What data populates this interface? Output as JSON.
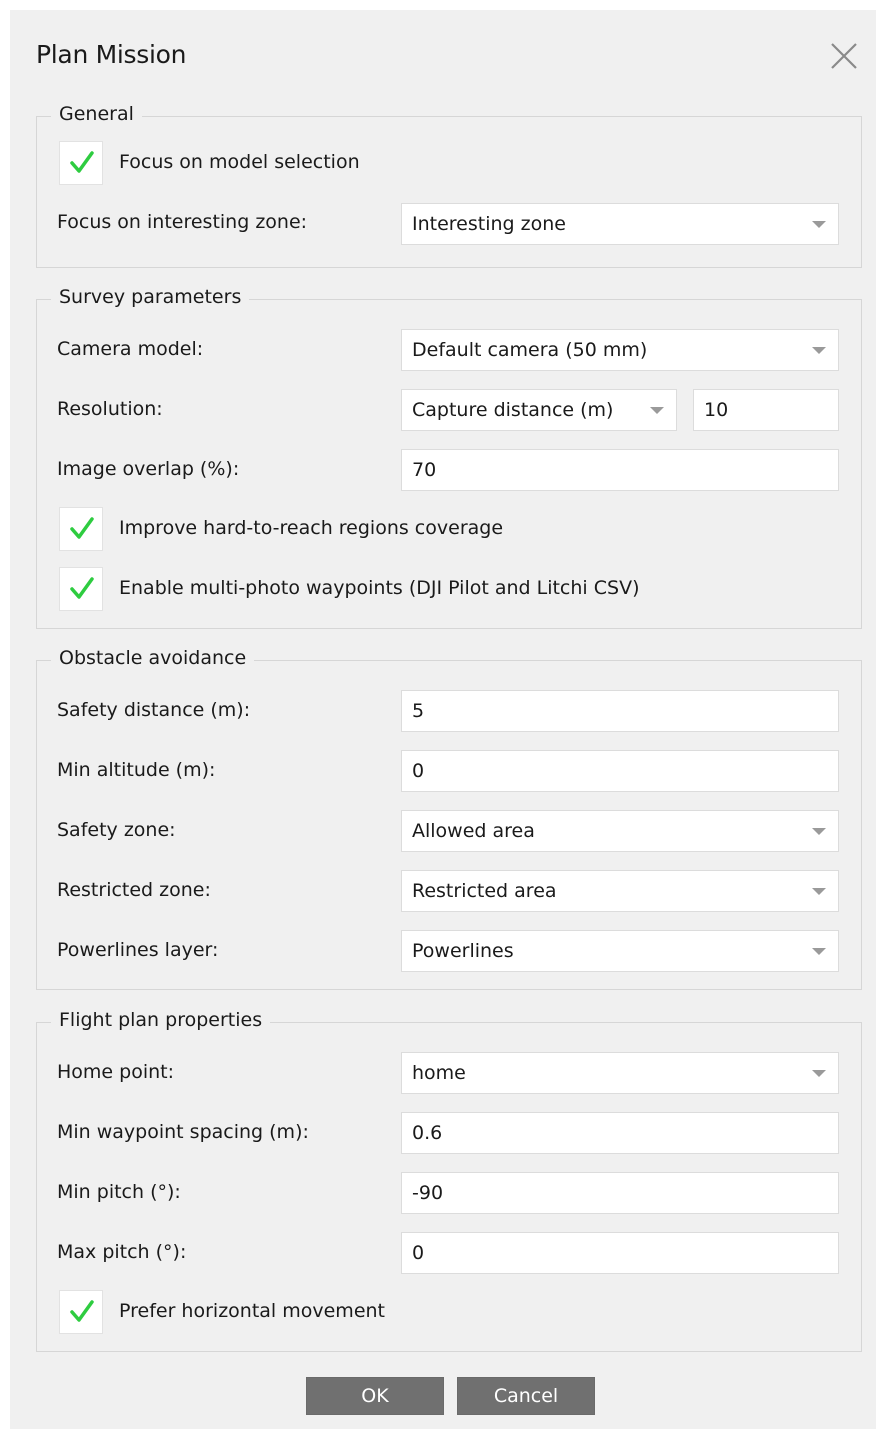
{
  "dialog": {
    "title": "Plan Mission"
  },
  "general": {
    "title": "General",
    "focus_model_label": "Focus on model selection",
    "focus_model_checked": true,
    "interesting_zone_label": "Focus on interesting zone:",
    "interesting_zone_value": "Interesting zone"
  },
  "survey": {
    "title": "Survey parameters",
    "camera_label": "Camera model:",
    "camera_value": "Default camera (50 mm)",
    "resolution_label": "Resolution:",
    "resolution_mode": "Capture distance (m)",
    "resolution_value": "10",
    "overlap_label": "Image overlap (%):",
    "overlap_value": "70",
    "hard_regions_label": "Improve hard-to-reach regions coverage",
    "hard_regions_checked": true,
    "multiphoto_label": "Enable multi-photo waypoints (DJI Pilot and Litchi CSV)",
    "multiphoto_checked": true
  },
  "obstacle": {
    "title": "Obstacle avoidance",
    "safety_distance_label": "Safety distance (m):",
    "safety_distance_value": "5",
    "min_altitude_label": "Min altitude (m):",
    "min_altitude_value": "0",
    "safety_zone_label": "Safety zone:",
    "safety_zone_value": "Allowed area",
    "restricted_zone_label": "Restricted zone:",
    "restricted_zone_value": "Restricted area",
    "powerlines_label": "Powerlines layer:",
    "powerlines_value": "Powerlines"
  },
  "flight": {
    "title": "Flight plan properties",
    "home_label": "Home point:",
    "home_value": "home",
    "spacing_label": "Min waypoint spacing (m):",
    "spacing_value": "0.6",
    "min_pitch_label": "Min pitch (°):",
    "min_pitch_value": "-90",
    "max_pitch_label": "Max pitch (°):",
    "max_pitch_value": "0",
    "horizontal_label": "Prefer horizontal movement",
    "horizontal_checked": true
  },
  "buttons": {
    "ok": "OK",
    "cancel": "Cancel"
  },
  "icons": {
    "close": "close-icon",
    "check": "checkmark-icon",
    "dropdown": "chevron-down-icon"
  },
  "colors": {
    "check": "#2ecc40",
    "button": "#707070",
    "background": "#f0f0f0"
  }
}
